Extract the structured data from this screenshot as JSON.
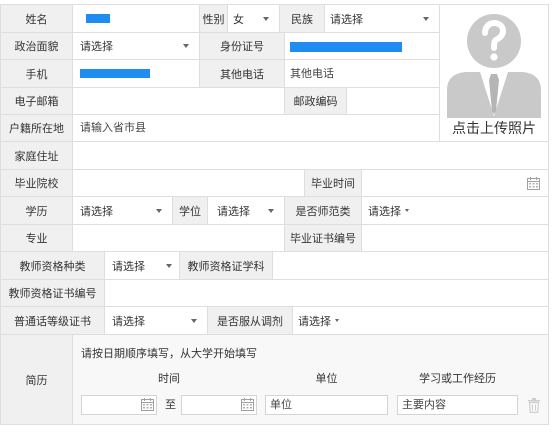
{
  "colors": {
    "label_background": "#f0f0f0",
    "border": "#dedede",
    "text": "#333333",
    "redacted_block": "#1e8cf0",
    "avatar_placeholder": "#c9c9c9"
  },
  "icons": {
    "select_arrow": "caret-down-icon",
    "date_picker": "calendar-icon",
    "photo_placeholder": "avatar-placeholder-icon",
    "remove_entry": "trash-icon"
  },
  "basic": {
    "name": {
      "label": "姓名"
    },
    "gender": {
      "label": "性别",
      "value": "女"
    },
    "ethnicity": {
      "label": "民族",
      "value": "请选择"
    },
    "political_status": {
      "label": "政治面貌",
      "value": "请选择"
    },
    "id_number": {
      "label": "身份证号"
    },
    "mobile": {
      "label": "手机"
    },
    "other_phone": {
      "label": "其他电话",
      "placeholder": "其他电话"
    },
    "email": {
      "label": "电子邮箱"
    },
    "postcode": {
      "label": "邮政编码"
    },
    "household_registration": {
      "label": "户籍所在地",
      "placeholder": "请输入省市县"
    },
    "home_address": {
      "label": "家庭住址"
    }
  },
  "photo": {
    "upload_label": "点击上传照片"
  },
  "education": {
    "school": {
      "label": "毕业院校"
    },
    "graduation_time": {
      "label": "毕业时间"
    },
    "education_level": {
      "label": "学历",
      "value": "请选择"
    },
    "degree": {
      "label": "学位",
      "value": "请选择"
    },
    "normal_major": {
      "label": "是否师范类",
      "value": "请选择"
    },
    "major": {
      "label": "专业"
    },
    "diploma_number": {
      "label": "毕业证书编号"
    }
  },
  "qualification": {
    "certificate_type": {
      "label": "教师资格种类",
      "value": "请选择"
    },
    "certificate_subject": {
      "label": "教师资格证学科"
    },
    "certificate_number": {
      "label": "教师资格证书编号"
    },
    "mandarin_certificate": {
      "label": "普通话等级证书",
      "value": "请选择"
    },
    "accept_reassignment": {
      "label": "是否服从调剂",
      "value": "请选择"
    }
  },
  "resume": {
    "label": "简历",
    "hint": "请按日期顺序填写，从大学开始填写",
    "columns": {
      "time": "时间",
      "unit": "单位",
      "experience": "学习或工作经历"
    },
    "entries": [
      {
        "separator": "至",
        "unit_placeholder": "单位",
        "content_placeholder": "主要内容"
      }
    ]
  }
}
